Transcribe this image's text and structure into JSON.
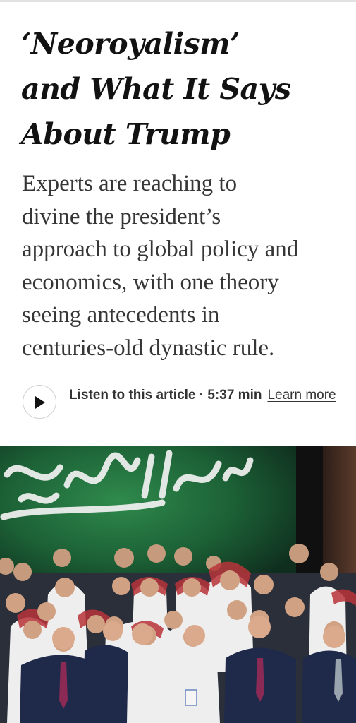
{
  "article": {
    "headline_lines": [
      "‘Neoroyalism’",
      "and What It Says",
      "About Trump"
    ],
    "summary_lines": [
      "Experts are reaching to",
      "divine the president’s",
      "approach to global policy and",
      "economics, with one theory",
      "seeing antecedents in",
      "centuries-old dynastic rule."
    ]
  },
  "audio": {
    "play_icon": "play-icon",
    "label": "Listen to this article · 5:37 min",
    "learn_more": "Learn more"
  },
  "photo": {
    "subject": "group-photo",
    "colors": {
      "flag": "#1f6b3c",
      "suit": "#1f2a4a",
      "thobe": "#efefef"
    }
  }
}
